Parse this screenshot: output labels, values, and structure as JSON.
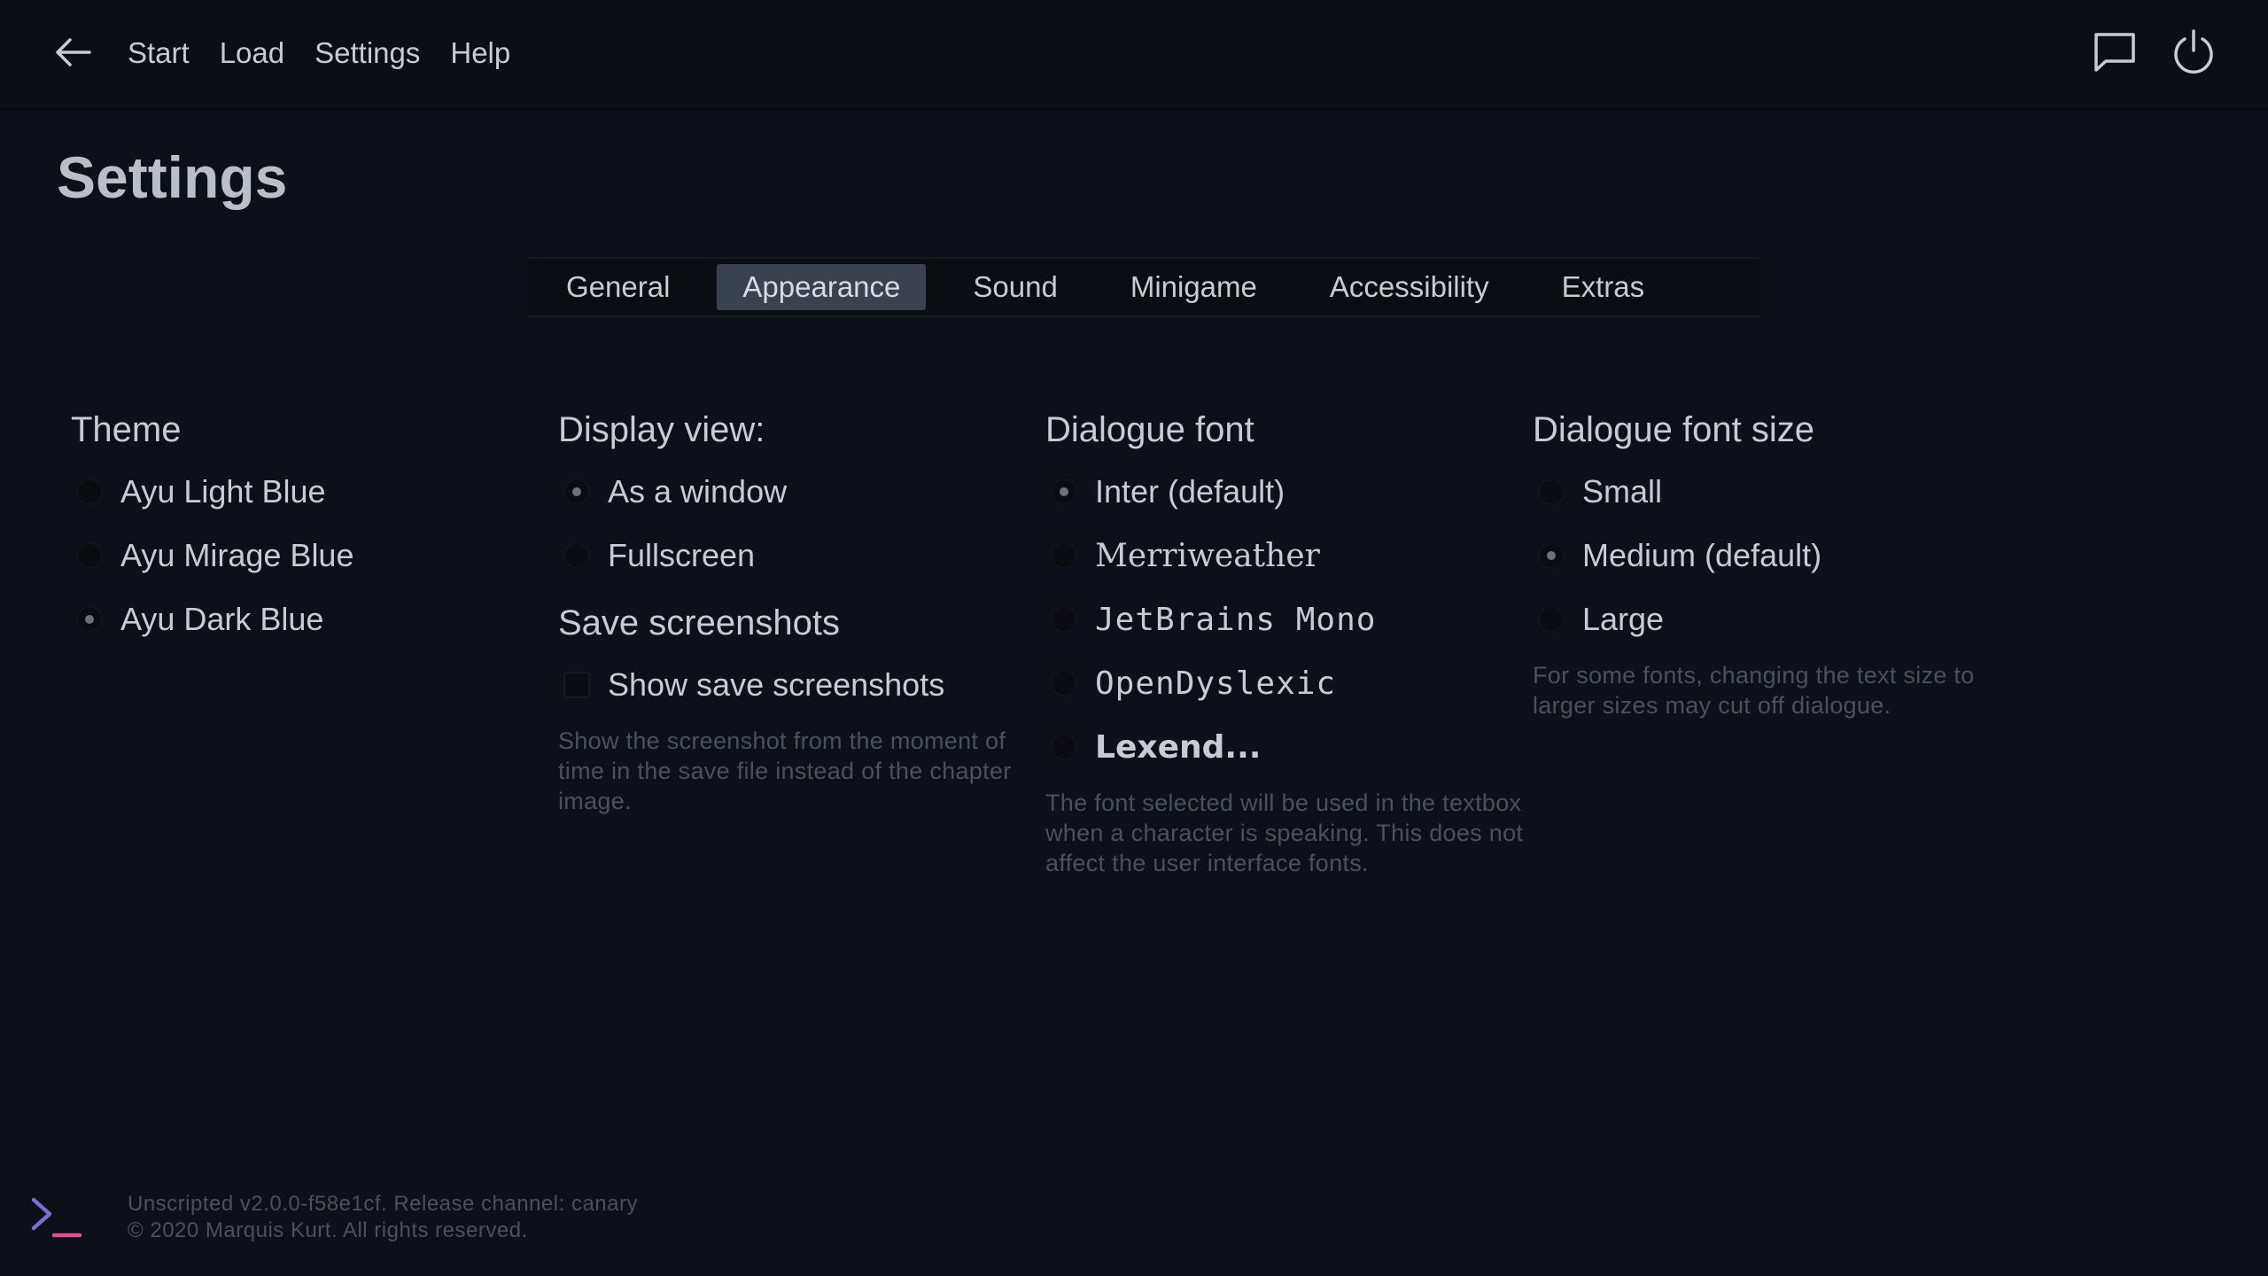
{
  "nav": {
    "items": [
      "Start",
      "Load",
      "Settings",
      "Help"
    ]
  },
  "page_title": "Settings",
  "tabs": [
    {
      "label": "General",
      "active": false
    },
    {
      "label": "Appearance",
      "active": true
    },
    {
      "label": "Sound",
      "active": false
    },
    {
      "label": "Minigame",
      "active": false
    },
    {
      "label": "Accessibility",
      "active": false
    },
    {
      "label": "Extras",
      "active": false
    }
  ],
  "theme": {
    "title": "Theme",
    "options": [
      "Ayu Light Blue",
      "Ayu Mirage Blue",
      "Ayu Dark Blue"
    ],
    "selected": "Ayu Dark Blue"
  },
  "display_view": {
    "title": "Display view:",
    "options": [
      "As a window",
      "Fullscreen"
    ],
    "selected": "As a window"
  },
  "save_screenshots": {
    "title": "Save screenshots",
    "checkbox_label": "Show save screenshots",
    "checked": false,
    "help": "Show the screenshot from the moment of time in the save file instead of the chapter image."
  },
  "dialogue_font": {
    "title": "Dialogue font",
    "options": [
      "Inter (default)",
      "Merriweather",
      "JetBrains Mono",
      "OpenDyslexic",
      "Lexend..."
    ],
    "selected": "Inter (default)",
    "help": "The font selected will be used in the textbox when a character is speaking. This does not affect the user interface fonts."
  },
  "dialogue_font_size": {
    "title": "Dialogue font size",
    "options": [
      "Small",
      "Medium (default)",
      "Large"
    ],
    "selected": "Medium (default)",
    "help": "For some fonts, changing the text size to larger sizes may cut off dialogue."
  },
  "footer": {
    "line1": "Unscripted v2.0.0-f58e1cf. Release channel: canary",
    "line2": "© 2020 Marquis Kurt. All rights reserved."
  },
  "icons": {
    "back": "arrow-left-icon",
    "feedback": "chat-bubble-icon",
    "quit": "power-icon",
    "logo": "terminal-prompt-logo"
  },
  "colors": {
    "background": "#0d1018",
    "active_tab": "#3a414f",
    "logo_chevron": "#7a6fd0",
    "logo_underscore": "#e0508a"
  }
}
